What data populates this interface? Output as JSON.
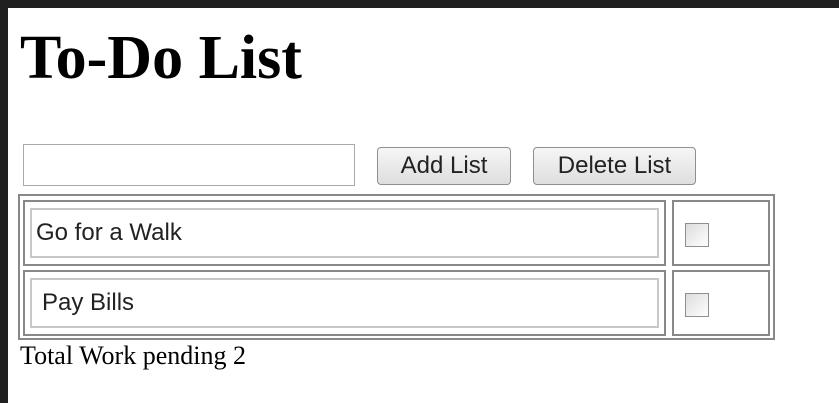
{
  "page": {
    "title": "To-Do List"
  },
  "controls": {
    "new_item_value": "",
    "add_button_label": "Add List",
    "delete_button_label": "Delete List"
  },
  "todos": [
    {
      "text": "Go for a Walk",
      "done": false
    },
    {
      "text": "Pay Bills",
      "done": false
    }
  ],
  "footer": {
    "pending_text": "Total Work pending 2"
  },
  "colors": {
    "window_frame": "#202020",
    "page_background": "#ffffff",
    "table_border": "#888888"
  }
}
